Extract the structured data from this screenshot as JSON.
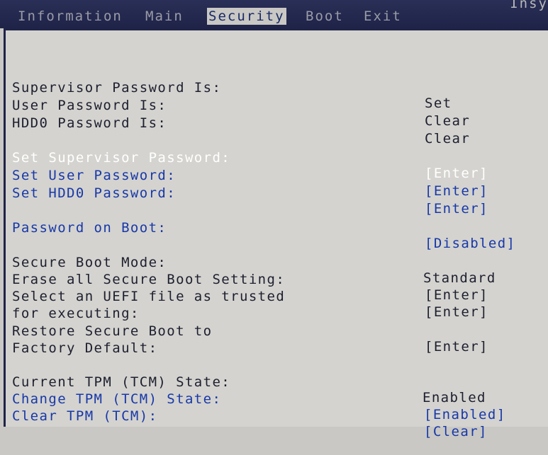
{
  "menu": {
    "tabs": [
      "Information",
      "Main",
      "Security",
      "Boot",
      "Exit"
    ],
    "active_tab": "Security",
    "brand_fragment": "Insy"
  },
  "settings": [
    {
      "label": "Supervisor Password Is:",
      "value": "Set",
      "style": "dark"
    },
    {
      "label": "User Password Is:",
      "value": "Clear",
      "style": "dark"
    },
    {
      "label": "HDD0 Password Is:",
      "value": "Clear",
      "style": "dark"
    },
    {
      "label": "Set Supervisor Password:",
      "value": "[Enter]",
      "style": "white"
    },
    {
      "label": "Set User Password:",
      "value": "[Enter]",
      "style": "blue"
    },
    {
      "label": "Set HDD0 Password:",
      "value": "[Enter]",
      "style": "blue"
    },
    {
      "label": "Password on Boot:",
      "value": "[Disabled]",
      "style": "blue"
    },
    {
      "label": "Secure Boot Mode:",
      "value": "Standard",
      "style": "dark"
    },
    {
      "label": "Erase all Secure Boot Setting:",
      "value": "[Enter]",
      "style": "dark"
    },
    {
      "label": "Select an UEFI file as trusted",
      "value": "[Enter]",
      "style": "dark"
    },
    {
      "label": "for executing:",
      "value": "",
      "style": "dark"
    },
    {
      "label": "Restore Secure Boot to",
      "value": "[Enter]",
      "style": "dark"
    },
    {
      "label": "Factory Default:",
      "value": "",
      "style": "dark"
    },
    {
      "label": "Current TPM (TCM) State:",
      "value": "Enabled",
      "style": "dark"
    },
    {
      "label": "Change TPM (TCM) State:",
      "value": "[Enabled]",
      "style": "blue"
    },
    {
      "label": "Clear TPM (TCM):",
      "value": "[Clear]",
      "style": "blue"
    }
  ]
}
